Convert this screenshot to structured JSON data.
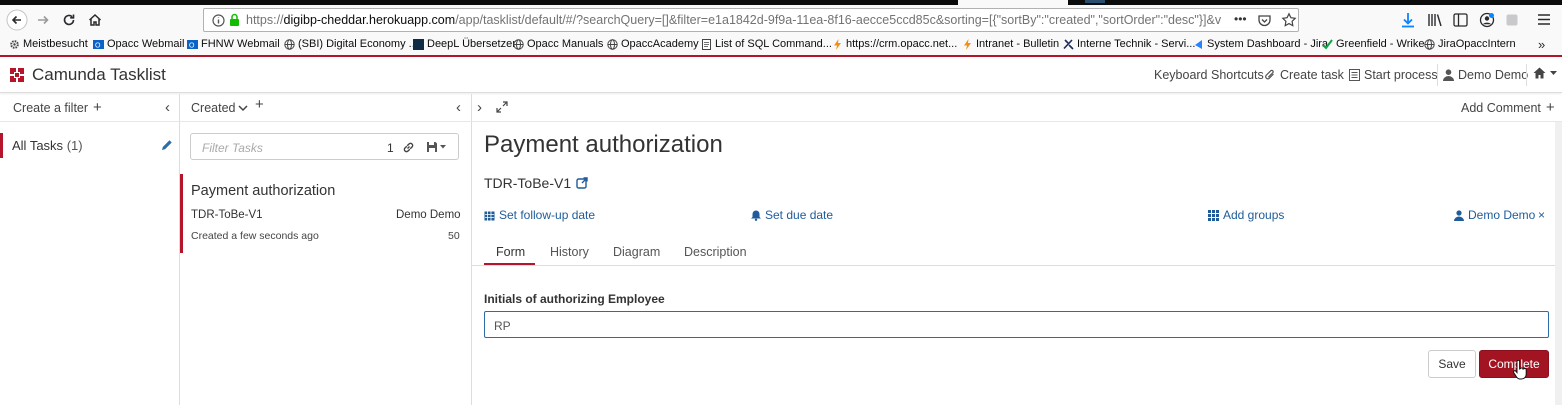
{
  "browser": {
    "url_prefix": "https://",
    "url_host": "digibp-cheddar.herokuapp.com",
    "url_rest": "/app/tasklist/default/#/?searchQuery=[]&filter=e1a1842d-9f9a-11ea-8f16-aecce5ccd85c&sorting=[{\"sortBy\":\"created\",\"sortOrder\":\"desc\"}]&viewbox={\"Def",
    "overflow_dots": "•••"
  },
  "bookmarks": [
    {
      "label": "Meistbesucht",
      "icon": "gear-icon"
    },
    {
      "label": "Opacc Webmail",
      "icon": "outlook-icon"
    },
    {
      "label": "FHNW Webmail",
      "icon": "outlook-icon"
    },
    {
      "label": "(SBI) Digital Economy ...",
      "icon": "globe-icon"
    },
    {
      "label": "DeepL Übersetzer",
      "icon": "deepl-icon"
    },
    {
      "label": "Opacc Manuals",
      "icon": "globe-icon"
    },
    {
      "label": "OpaccAcademy",
      "icon": "globe-icon"
    },
    {
      "label": "List of SQL Command...",
      "icon": "doc-icon"
    },
    {
      "label": "https://crm.opacc.net...",
      "icon": "bolt-icon"
    },
    {
      "label": "Intranet - Bulletin",
      "icon": "bolt-icon"
    },
    {
      "label": "Interne Technik - Servi...",
      "icon": "wrench-icon"
    },
    {
      "label": "System Dashboard - Jira",
      "icon": "jira-icon"
    },
    {
      "label": "Greenfield - Wrike",
      "icon": "check-icon"
    },
    {
      "label": "JiraOpaccIntern",
      "icon": "globe-icon"
    }
  ],
  "header": {
    "title": "Camunda Tasklist",
    "keyboard_shortcuts": "Keyboard Shortcuts",
    "create_task": "Create task",
    "start_process": "Start process",
    "user": "Demo Demo"
  },
  "filters": {
    "create_label": "Create a filter",
    "items": [
      {
        "name": "All Tasks",
        "count": "(1)"
      }
    ]
  },
  "tasklist": {
    "sort_label": "Created",
    "filter_placeholder": "Filter Tasks",
    "filter_count": "1",
    "task": {
      "name": "Payment authorization",
      "process": "TDR-ToBe-V1",
      "assignee": "Demo Demo",
      "created": "Created a few seconds ago",
      "priority": "50"
    }
  },
  "detail": {
    "add_comment": "Add Comment",
    "title": "Payment authorization",
    "process": "TDR-ToBe-V1",
    "follow_up": "Set follow-up date",
    "due_date": "Set due date",
    "add_groups": "Add groups",
    "assignee": "Demo Demo",
    "tabs": [
      "Form",
      "History",
      "Diagram",
      "Description"
    ],
    "form": {
      "field_label": "Initials of authorizing Employee",
      "field_value": "RP",
      "save": "Save",
      "complete": "Complete"
    }
  },
  "colors": {
    "accent": "#b5152b",
    "link": "#1f5c99",
    "complete_button": "#a31422"
  }
}
